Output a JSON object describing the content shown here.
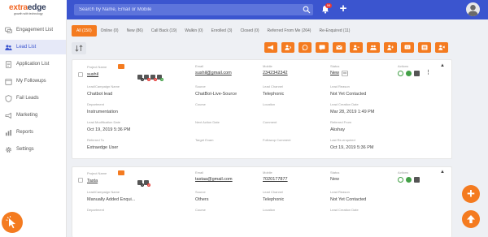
{
  "app": {
    "logo_primary": "extra",
    "logo_secondary": "edge",
    "logo_tagline": "growth with technology"
  },
  "header": {
    "search_placeholder": "Search by Name, Email or Mobile",
    "notification_count": "99"
  },
  "sidebar": {
    "items": [
      {
        "label": "Engagement List",
        "icon": "chat-bubbles-icon"
      },
      {
        "label": "Lead List",
        "icon": "people-icon"
      },
      {
        "label": "Application List",
        "icon": "document-icon"
      },
      {
        "label": "My Followups",
        "icon": "calendar-icon"
      },
      {
        "label": "Fail Leads",
        "icon": "shield-icon"
      },
      {
        "label": "Marketing",
        "icon": "megaphone-icon"
      },
      {
        "label": "Reports",
        "icon": "bar-chart-icon"
      },
      {
        "label": "Settings",
        "icon": "gear-icon"
      }
    ]
  },
  "filter_tabs": [
    {
      "label": "All (150)",
      "active": true
    },
    {
      "label": "Online (0)",
      "active": false
    },
    {
      "label": "New (86)",
      "active": false
    },
    {
      "label": "Call Back (19)",
      "active": false
    },
    {
      "label": "Walkin (0)",
      "active": false
    },
    {
      "label": "Enrolled (3)",
      "active": false
    },
    {
      "label": "Closed (0)",
      "active": false
    },
    {
      "label": "Referred From Me (264)",
      "active": false
    },
    {
      "label": "Re-Enquired (11)",
      "active": false
    }
  ],
  "toolbar_icons": [
    "megaphone-icon",
    "assign-user-icon",
    "whatsapp-icon",
    "message-icon",
    "email-icon",
    "transfer-user-icon",
    "group-icon",
    "add-user-icon",
    "sms-icon",
    "list-icon",
    "delete-user-icon"
  ],
  "labels": {
    "project_name": "Project Name",
    "email": "Email",
    "mobile": "Mobile",
    "status": "Status",
    "actions": "Actions",
    "lead_campaign_name": "Lead/Campaign Name",
    "source": "Source",
    "lead_channel": "Lead Channel",
    "lead_reason": "Lead Reason",
    "department": "Department",
    "course": "Course",
    "location": "Location",
    "lead_creation_date": "Lead Creation Date",
    "lead_modification_date": "Lead Modification Date",
    "next_action_date": "Next Action Date",
    "comment": "Comment",
    "referred_from": "Referred From",
    "referred_to": "Referred To",
    "target_exam": "Target Exam",
    "followup_comment": "Followup Comment",
    "last_re_enquired": "Last Re-enquired"
  },
  "leads": [
    {
      "name": "sushil",
      "email": "sushil@gmail.com",
      "mobile": "2342342342",
      "status": "New",
      "lead_campaign_name": "Chatbot lead",
      "source": "ChatBot-Live-Source",
      "lead_channel": "Telephonic",
      "lead_reason": "Not Yet Contacted",
      "department": "Instrumentation",
      "course": "",
      "location": "",
      "lead_creation_date": "Mar 28, 2019 1:49 PM",
      "lead_modification_date": "Oct 19, 2019 5:36 PM",
      "next_action_date": "",
      "comment": "",
      "referred_from": "Akshay",
      "referred_to": "Extraedge User",
      "target_exam": "",
      "followup_comment": "",
      "last_re_enquired": "Oct 19, 2019 5:36 PM"
    },
    {
      "name": "Tasta",
      "email": "tastaa@gmail.com",
      "mobile": "7020177877",
      "status": "New",
      "lead_campaign_name": "Manually Added Enqui...",
      "source": "Others",
      "lead_channel": "Telephonic",
      "lead_reason": "Not Yet Contacted"
    }
  ],
  "colors": {
    "topbar": "#3b55cf",
    "accent": "#f47b20",
    "sidebar_active": "#e6e9f8"
  }
}
